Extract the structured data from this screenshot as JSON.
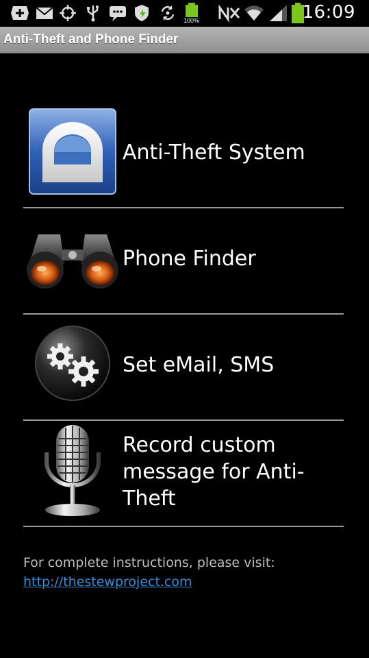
{
  "status_bar": {
    "time": "16:09",
    "battery_small_label": "100%",
    "icons": [
      "add-icon",
      "email-icon",
      "gps-icon",
      "usb-icon",
      "chat-icon",
      "shield-icon",
      "sync-icon",
      "battery-full-icon",
      "no-sim-icon",
      "wifi-icon",
      "signal-icon",
      "battery-icon"
    ]
  },
  "titlebar": {
    "title": "Anti-Theft and Phone Finder"
  },
  "menu": {
    "items": [
      {
        "label": "Anti-Theft System",
        "icon": "lock-icon"
      },
      {
        "label": "Phone Finder",
        "icon": "binoculars-icon"
      },
      {
        "label": "Set eMail, SMS",
        "icon": "gears-icon"
      },
      {
        "label": "Record custom message for Anti-Theft",
        "icon": "microphone-icon"
      }
    ]
  },
  "footer": {
    "instructions": "For complete instructions, please visit:",
    "link": "http://thestewproject.com"
  },
  "colors": {
    "background": "#000000",
    "link": "#2f8fd8",
    "title_bar": "#a0a0a0",
    "battery_green": "#7bc61e"
  }
}
